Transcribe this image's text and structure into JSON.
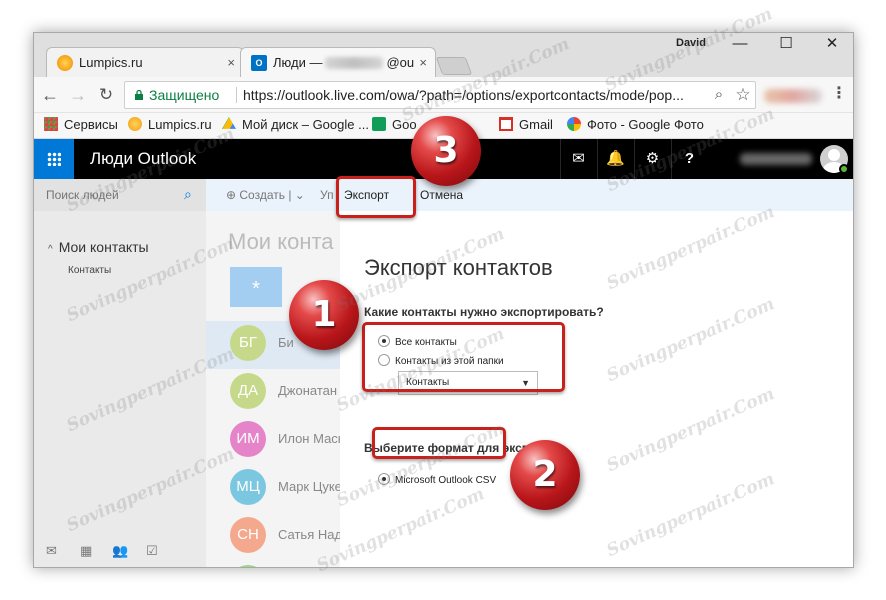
{
  "browser": {
    "tabs": [
      {
        "title": "Lumpics.ru",
        "close": "×"
      },
      {
        "title_prefix": "Люди —",
        "title_suffix": "@ou",
        "close": "×",
        "favicon": "O"
      }
    ],
    "profile_name": "David",
    "window_buttons": {
      "minimize": "—",
      "maximize": "☐",
      "close": "✕"
    },
    "nav": {
      "back": "←",
      "forward": "→",
      "reload": "↻"
    },
    "secure_label": "Защищено",
    "url": "https://outlook.live.com/owa/?path=/options/exportcontacts/mode/pop...",
    "zoom_icon": "⌕",
    "star_icon": "☆",
    "menu_icon": "⋮",
    "bookmarks": [
      "Сервисы",
      "Lumpics.ru",
      "Мой диск – Google ...",
      "Goo",
      "Gmail",
      "Фото - Google Фото"
    ]
  },
  "app": {
    "title": "Люди Outlook",
    "header_icons": {
      "chat": "✉",
      "bell": "🔔",
      "gear": "⚙",
      "help": "?"
    },
    "search_placeholder": "Поиск людей",
    "search_icon": "⌕",
    "nav_section": "Мои контакты",
    "nav_section_arrow": "^",
    "nav_sub": "Контакты",
    "nav_icons": [
      "✉",
      "▦",
      "👥",
      "☑"
    ],
    "commands": {
      "create": "⊕ Создать | ⌄",
      "manage": "Уп",
      "export": "Экспорт",
      "cancel": "Отмена"
    }
  },
  "contacts": {
    "list_title": "Мои конта",
    "favorite_symbol": "*",
    "items": [
      {
        "initials": "БГ",
        "name": "Би",
        "color": "#c6d98b",
        "selected": true
      },
      {
        "initials": "ДА",
        "name": "Джонатан",
        "color": "#c6d98b",
        "selected": false
      },
      {
        "initials": "ИМ",
        "name": "Илон Маск",
        "color": "#e584c8",
        "selected": false
      },
      {
        "initials": "МЦ",
        "name": "Марк Цукер",
        "color": "#7bc7e0",
        "selected": false
      },
      {
        "initials": "СН",
        "name": "Сатья Наде",
        "color": "#f4a98f",
        "selected": false
      },
      {
        "initials": "",
        "name": "",
        "color": "#9fd68a",
        "selected": false
      }
    ]
  },
  "export_panel": {
    "title": "Экспорт контактов",
    "question1": "Какие контакты нужно экспортировать?",
    "option_all": "Все контакты",
    "option_folder": "Контакты из этой папки",
    "folder_select_value": "Контакты",
    "select_arrow": "▼",
    "question2": "Выберите формат для экспорта",
    "format_csv": "Microsoft Outlook CSV"
  },
  "annotations": {
    "step1": "1",
    "step2": "2",
    "step3": "3",
    "accent": "#c8201b"
  },
  "watermark": "Sovingperpair.Com"
}
